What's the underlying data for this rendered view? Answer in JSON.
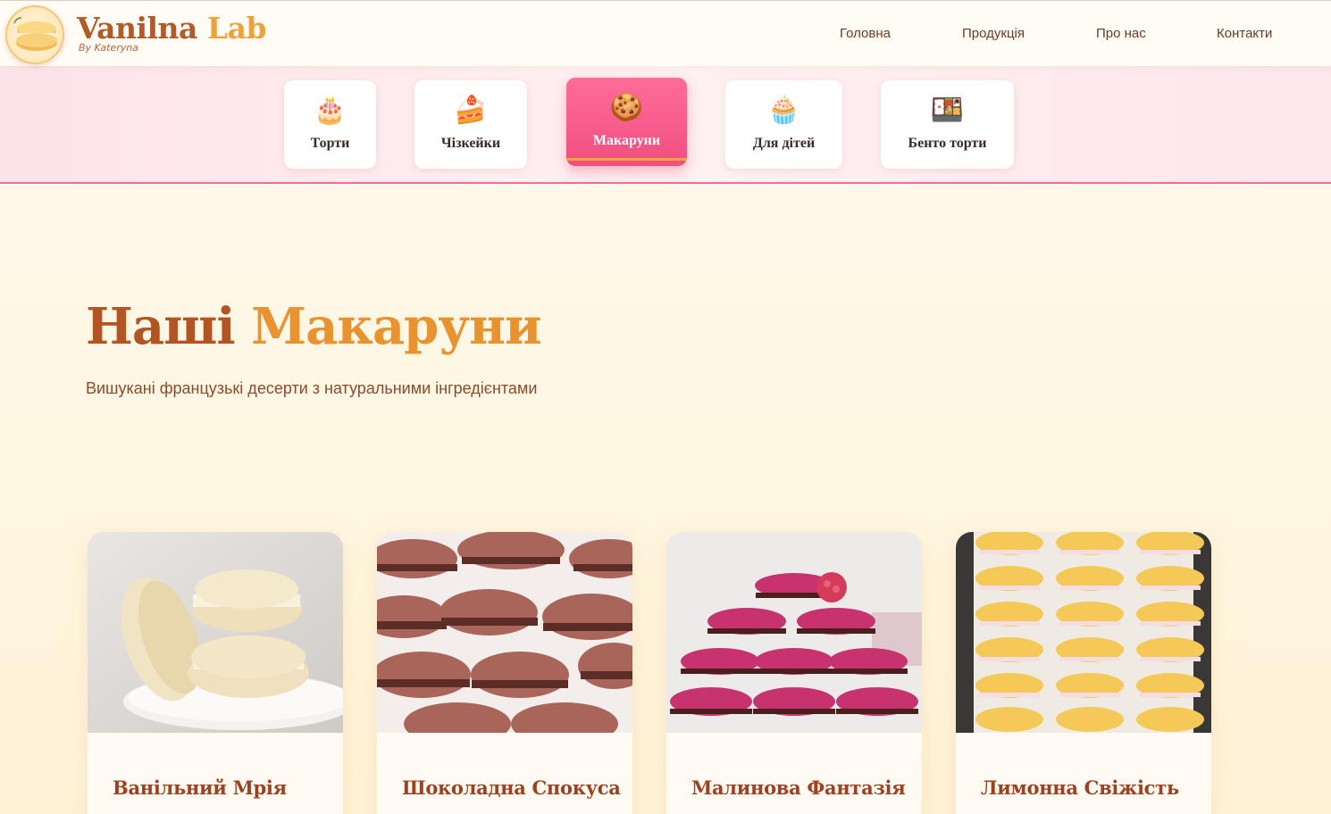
{
  "brand": {
    "name_part1": "Vanilna",
    "name_part2": "Lab",
    "byline": "By Kateryna",
    "logo_icon": "macaron-logo-icon"
  },
  "nav": {
    "items": [
      {
        "label": "Головна"
      },
      {
        "label": "Продукція"
      },
      {
        "label": "Про нас"
      },
      {
        "label": "Контакти"
      }
    ]
  },
  "categories": [
    {
      "label": "Торти",
      "icon": "🎂",
      "active": false
    },
    {
      "label": "Чізкейки",
      "icon": "🍰",
      "active": false
    },
    {
      "label": "Макаруни",
      "icon": "🍪",
      "active": true
    },
    {
      "label": "Для дітей",
      "icon": "🧁",
      "active": false
    },
    {
      "label": "Бенто торти",
      "icon": "🍱",
      "active": false
    }
  ],
  "hero": {
    "title_part1": "Наші",
    "title_part2": "Макаруни",
    "subtitle": "Вишукані французькі десерти з натуральними інгредієнтами"
  },
  "products": [
    {
      "name": "Ванільний Мрія",
      "image": "vanilla-macarons-photo"
    },
    {
      "name": "Шоколадна Спокуса",
      "image": "chocolate-macarons-photo"
    },
    {
      "name": "Малинова Фантазія",
      "image": "raspberry-macarons-photo"
    },
    {
      "name": "Лимонна Свіжість",
      "image": "lemon-macarons-photo"
    }
  ],
  "colors": {
    "brand_brown": "#b25a2a",
    "brand_orange": "#f0a23a",
    "active_pink": "#ef4f7f",
    "underline_orange": "#f8a43d"
  }
}
